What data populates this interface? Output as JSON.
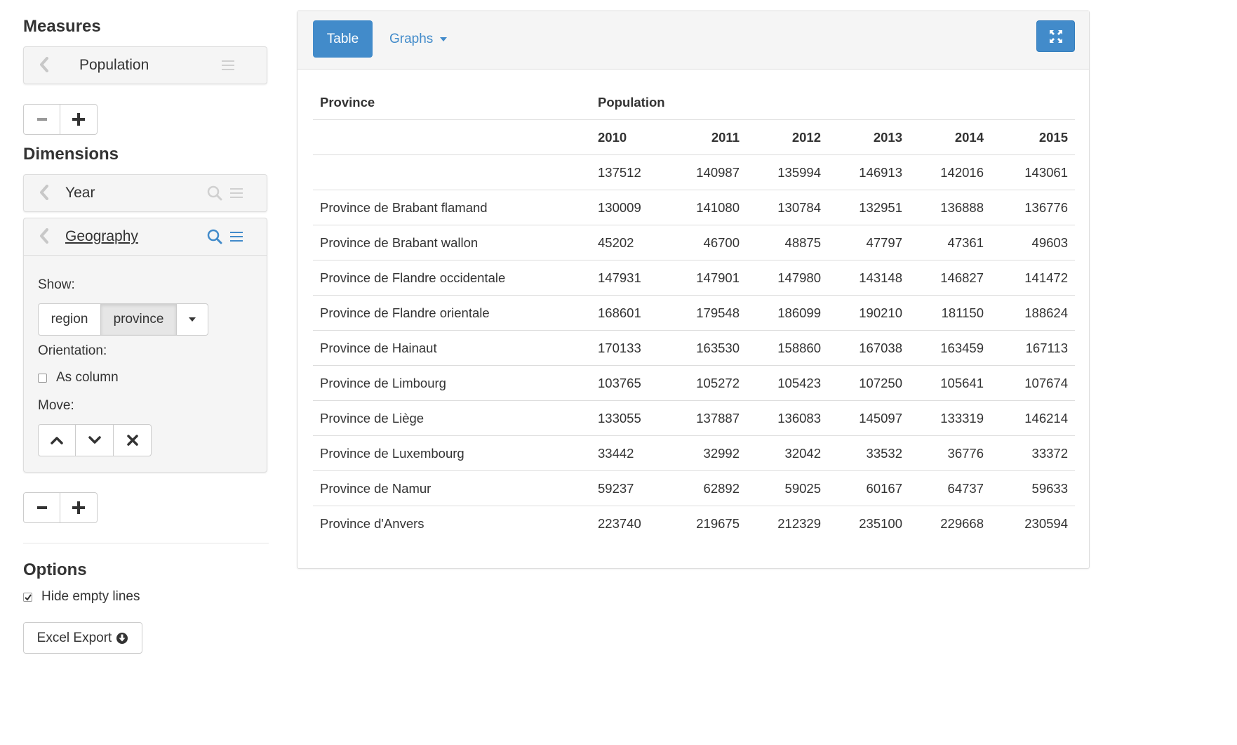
{
  "sidebar": {
    "measures_title": "Measures",
    "measure": {
      "label": "Population"
    },
    "dimensions_title": "Dimensions",
    "dimension_year": {
      "label": "Year"
    },
    "dimension_geo": {
      "label": "Geography",
      "show_label": "Show:",
      "show_options": [
        "region",
        "province"
      ],
      "show_selected": "province",
      "orientation_label": "Orientation:",
      "as_column_label": "As column",
      "as_column_checked": false,
      "move_label": "Move:"
    },
    "options_title": "Options",
    "hide_empty_label": "Hide empty lines",
    "hide_empty_checked": true,
    "export_label": "Excel Export"
  },
  "panel": {
    "tab_table": "Table",
    "tab_graphs": "Graphs"
  },
  "table": {
    "header_row_label": "Province",
    "measure_header": "Population",
    "years": [
      "2010",
      "2011",
      "2012",
      "2013",
      "2014",
      "2015"
    ],
    "rows": [
      {
        "name": "",
        "values": [
          "137512",
          "140987",
          "135994",
          "146913",
          "142016",
          "143061"
        ]
      },
      {
        "name": "Province de Brabant flamand",
        "values": [
          "130009",
          "141080",
          "130784",
          "132951",
          "136888",
          "136776"
        ]
      },
      {
        "name": "Province de Brabant wallon",
        "values": [
          "45202",
          "46700",
          "48875",
          "47797",
          "47361",
          "49603"
        ]
      },
      {
        "name": "Province de Flandre occidentale",
        "values": [
          "147931",
          "147901",
          "147980",
          "143148",
          "146827",
          "141472"
        ]
      },
      {
        "name": "Province de Flandre orientale",
        "values": [
          "168601",
          "179548",
          "186099",
          "190210",
          "181150",
          "188624"
        ]
      },
      {
        "name": "Province de Hainaut",
        "values": [
          "170133",
          "163530",
          "158860",
          "167038",
          "163459",
          "167113"
        ]
      },
      {
        "name": "Province de Limbourg",
        "values": [
          "103765",
          "105272",
          "105423",
          "107250",
          "105641",
          "107674"
        ]
      },
      {
        "name": "Province de Liège",
        "values": [
          "133055",
          "137887",
          "136083",
          "145097",
          "133319",
          "146214"
        ]
      },
      {
        "name": "Province de Luxembourg",
        "values": [
          "33442",
          "32992",
          "32042",
          "33532",
          "36776",
          "33372"
        ]
      },
      {
        "name": "Province de Namur",
        "values": [
          "59237",
          "62892",
          "59025",
          "60167",
          "64737",
          "59633"
        ]
      },
      {
        "name": "Province d'Anvers",
        "values": [
          "223740",
          "219675",
          "212329",
          "235100",
          "229668",
          "230594"
        ]
      }
    ]
  },
  "colors": {
    "accent": "#428bca",
    "panel_bg": "#f5f5f5",
    "border": "#dddddd"
  }
}
